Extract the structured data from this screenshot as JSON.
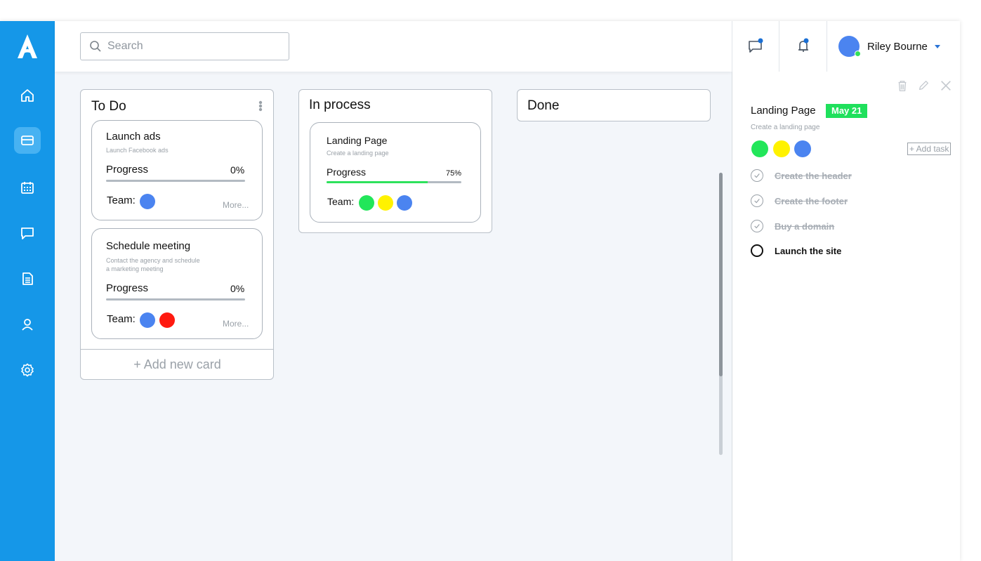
{
  "search": {
    "placeholder": "Search"
  },
  "user": {
    "name": "Riley Bourne"
  },
  "topbar": {
    "icons": [
      "chat-icon",
      "bell-icon"
    ]
  },
  "sidebar": {
    "items": [
      "home-icon",
      "board-icon",
      "calendar-icon",
      "messages-icon",
      "document-icon",
      "user-icon",
      "settings-icon"
    ],
    "active": "board-icon"
  },
  "board": {
    "columns": [
      {
        "title": "To Do",
        "add_card": "+ Add new card",
        "cards": [
          {
            "title": "Launch ads",
            "subtitle": "Launch Facebook ads",
            "progress_label": "Progress",
            "progress": "0%",
            "progress_fraction": 0,
            "team_label": "Team:",
            "team_colors": [
              "#4b84f0"
            ],
            "more": "More..."
          },
          {
            "title": "Schedule meeting",
            "subtitle_line1": "Contact the agency and schedule",
            "subtitle_line2": "a marketing meeting",
            "progress_label": "Progress",
            "progress": "0%",
            "progress_fraction": 0,
            "team_label": "Team:",
            "team_colors": [
              "#4b84f0",
              "#ff1a10"
            ],
            "more": "More..."
          }
        ]
      },
      {
        "title": "In process",
        "cards": [
          {
            "title": "Landing Page",
            "subtitle": "Create a landing page",
            "progress_label": "Progress",
            "progress": "75%",
            "progress_fraction": 0.75,
            "team_label": "Team:",
            "team_colors": [
              "#22e65a",
              "#fff200",
              "#4b84f0"
            ]
          }
        ]
      },
      {
        "title": "Done",
        "cards": []
      }
    ]
  },
  "detail": {
    "title": "Landing Page",
    "date": "May 21",
    "subtitle": "Create a landing page",
    "team_colors": [
      "#22e65a",
      "#fff200",
      "#4b84f0"
    ],
    "add_task": "+ Add task",
    "tasks": [
      {
        "label": "Create the header",
        "done": true
      },
      {
        "label": "Create the footer",
        "done": true
      },
      {
        "label": "Buy a domain",
        "done": true
      },
      {
        "label": "Launch the site",
        "done": false
      }
    ],
    "actions": [
      "trash-icon",
      "pencil-icon",
      "close-icon"
    ]
  },
  "colors": {
    "sidebar": "#1597e8",
    "accent_green": "#1fe05c",
    "progress_fill": "#2ee25c"
  }
}
